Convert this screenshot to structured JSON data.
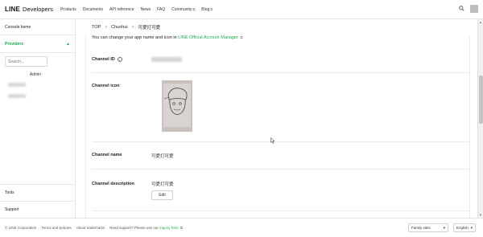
{
  "header": {
    "logo_line": "LINE",
    "logo_dev": "Developers",
    "nav": [
      {
        "label": "Products",
        "external": false
      },
      {
        "label": "Documents",
        "external": false
      },
      {
        "label": "API reference",
        "external": false
      },
      {
        "label": "News",
        "external": false
      },
      {
        "label": "FAQ",
        "external": false
      },
      {
        "label": "Community",
        "external": true
      },
      {
        "label": "Blog",
        "external": true
      }
    ],
    "icons": {
      "search": "search-icon",
      "avatar": "avatar"
    }
  },
  "sidebar": {
    "console_home": "Console home",
    "providers": "Providers",
    "search_placeholder": "Search...",
    "admin_label": "Admin",
    "tools": "Tools",
    "support": "Support"
  },
  "breadcrumb": {
    "items": [
      "TOP",
      "Chunhui",
      "可愛打可愛"
    ],
    "separator": ">"
  },
  "main": {
    "note_text": "You can change your app name and icon in",
    "note_link": "LINE Official Account Manager",
    "channel_id_label": "Channel ID",
    "channel_icon_label": "Channel icon",
    "channel_name_label": "Channel name",
    "channel_name_value": "可愛打可愛",
    "channel_desc_label": "Channel description",
    "channel_desc_value": "可愛打可愛",
    "edit_button": "Edit"
  },
  "footer": {
    "copyright": "© LINE Corporation",
    "terms": "Terms and policies",
    "trademarks": "About trademarks",
    "need_support": "Need support? Please use our",
    "inquiry_form": "inquiry form",
    "family_sites": "Family sites",
    "language": "English"
  },
  "colors": {
    "accent": "#1ea84e",
    "border": "#e4e4e4"
  }
}
